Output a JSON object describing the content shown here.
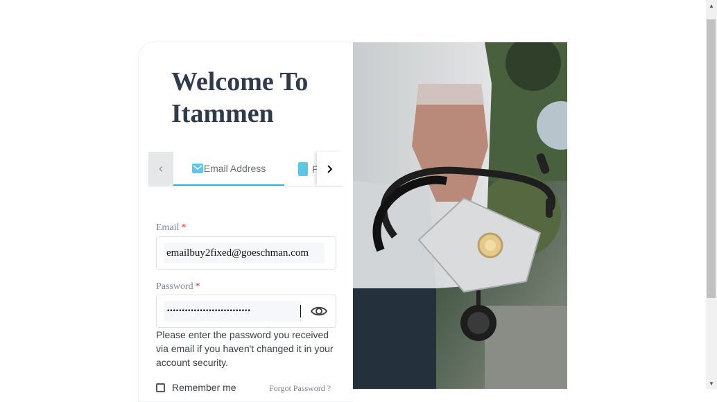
{
  "login": {
    "title": "Welcome To Itammen",
    "tabs": {
      "prev_icon": "chevron-left-icon",
      "email_tab": "Email Address",
      "email_tab_icon": "mail-icon",
      "phone_tab": "P",
      "phone_tab_icon": "phone-icon",
      "next_icon": "chevron-right-icon"
    },
    "email": {
      "label": "Email",
      "required_mark": "*",
      "value": "emailbuy2fixed@goeschman.com"
    },
    "password": {
      "label": "Password",
      "required_mark": "*",
      "value": "••••••••••••••••••••••••••••",
      "toggle_icon": "eye-icon"
    },
    "hint": "Please enter the password you received via email if you haven't changed it in your account security.",
    "remember_label": "Remember me",
    "remember_checked": false,
    "forgot_label": "Forgot Password ?"
  },
  "colors": {
    "accent": "#2fb3cf",
    "title": "#2f3a4a",
    "required": "#e02424"
  },
  "photo": {
    "subject": "healthcare worker holding stethoscope and face mask"
  }
}
